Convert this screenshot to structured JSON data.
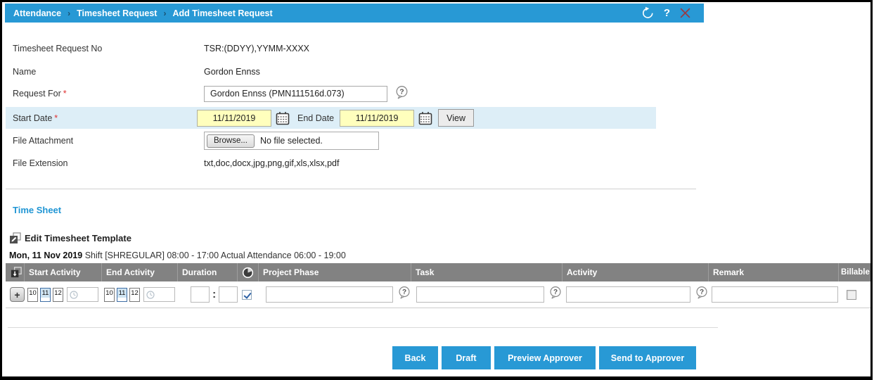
{
  "colors": {
    "header_bar": "#2899d5",
    "breadcrumb_separator": "#1a4f6e",
    "close_icon": "#993b42",
    "highlight_row": "#ddeef7",
    "input_highlight_yellow": "#ffffbd",
    "table_header_bg": "#828282",
    "button_blue": "#2899d5",
    "link_blue": "#2196d4",
    "required_red": "#e03131"
  },
  "icons": {
    "help_glyph": "?",
    "question_glyph": "?",
    "plus_glyph": "+"
  },
  "breadcrumb": {
    "separator": "›",
    "items": [
      "Attendance",
      "Timesheet Request",
      "Add Timesheet Request"
    ]
  },
  "form": {
    "required_marker": "*",
    "timesheet_request_no": {
      "label": "Timesheet Request No",
      "value": "TSR:(DDYY),YYMM-XXXX"
    },
    "name": {
      "label": "Name",
      "value": "Gordon Ennss"
    },
    "request_for": {
      "label": "Request For",
      "value": "Gordon Ennss (PMN111516d.073)"
    },
    "start_date": {
      "label": "Start Date",
      "value": "11/11/2019"
    },
    "end_date": {
      "label": "End Date",
      "value": "11/11/2019"
    },
    "view_button_label": "View",
    "file_attachment": {
      "label": "File Attachment",
      "browse_label": "Browse...",
      "status": "No file selected."
    },
    "file_extension": {
      "label": "File Extension",
      "value": "txt,doc,docx,jpg,png,gif,xls,xlsx,pdf"
    }
  },
  "timesheet": {
    "section_title": "Time Sheet",
    "edit_template_label": "Edit Timesheet Template",
    "day_heading": {
      "date": "Mon, 11 Nov 2019",
      "details": "Shift [SHREGULAR] 08:00 - 17:00 Actual Attendance 06:00 - 19:00"
    },
    "table": {
      "columns": [
        "Start Activity",
        "End Activity",
        "Duration",
        "Project Phase",
        "Task",
        "Activity",
        "Remark",
        "Billable"
      ],
      "row": {
        "start_day_options": [
          "10",
          "11",
          "12"
        ],
        "start_day_selected": "11",
        "end_day_options": [
          "10",
          "11",
          "12"
        ],
        "end_day_selected": "11",
        "start_time_value": "",
        "end_time_value": "",
        "duration_hh": "",
        "duration_mm": "",
        "duration_separator": ":",
        "use_time_checkbox_checked": true,
        "project_phase_value": "",
        "task_value": "",
        "activity_value": "",
        "remark_value": "",
        "billable_checked": false
      }
    }
  },
  "footer": {
    "buttons": [
      "Back",
      "Draft",
      "Preview Approver",
      "Send to Approver"
    ]
  }
}
